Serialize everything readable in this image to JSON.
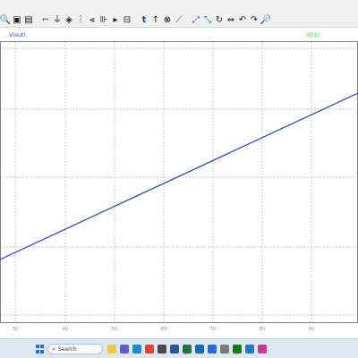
{
  "toolbar": {
    "icons": [
      "zoom-icon",
      "zoom-to-fit-icon",
      "autoscale-icon",
      "cursor-icon",
      "ground-icon",
      "component-icon",
      "resistor-icon",
      "capacitor-icon",
      "inductor-icon",
      "diode-icon",
      "label-icon",
      "text-icon",
      "spice-directive-icon",
      "halt-icon",
      "wire-icon",
      "move-icon",
      "drag-icon",
      "rotate-icon",
      "mirror-icon",
      "undo-icon",
      "redo-icon",
      "find-icon"
    ],
    "glyphs": [
      "🔍",
      "▣",
      "▤",
      "⌐",
      "⏚",
      "◈",
      "⫶",
      "⫷",
      "⊪",
      "▸",
      "⊟",
      "t",
      "↑",
      "⊗",
      "⟋",
      "⤢",
      "⤡",
      "↻",
      "⇔",
      "↶",
      "↷",
      "🔎"
    ]
  },
  "traces": {
    "left_label": "V(out)",
    "left_color": "#1f3fbf",
    "right_label": "I(D1)",
    "right_color": "#33cc33"
  },
  "chart_data": {
    "type": "line",
    "title": "",
    "xlabel": "",
    "ylabel": "",
    "x_ticks": [
      "3V",
      "4V",
      "5V",
      "6V",
      "7V",
      "8V",
      "9V"
    ],
    "series": [
      {
        "name": "V(out)",
        "color": "#1f3fbf",
        "x": [
          2.7,
          9.8
        ],
        "y": [
          0.0,
          1.0
        ]
      }
    ],
    "grid": true,
    "line_color": "#1f3fbf",
    "grid_color": "#9a9a9a"
  },
  "taskbar": {
    "search_placeholder": "Search",
    "apps": [
      "file-explorer-icon",
      "teams-icon",
      "edge-icon",
      "chrome-icon",
      "store-icon",
      "word-icon",
      "excel-icon",
      "outlook-icon",
      "ltspice-icon",
      "settings-icon",
      "xbox-icon",
      "mail-icon",
      "photos-icon"
    ]
  }
}
